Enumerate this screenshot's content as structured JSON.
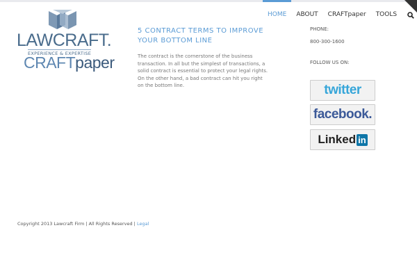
{
  "logo": {
    "law": "LAWCRAFT.",
    "tagline": "EXPERIENCE & EXPERTISE",
    "craft": "CRAFT",
    "paper": "paper"
  },
  "nav": {
    "items": [
      {
        "label": "HOME"
      },
      {
        "label": "ABOUT"
      },
      {
        "label": "CRAFTpaper"
      },
      {
        "label": "TOOLS"
      }
    ],
    "search_icon": "search-icon"
  },
  "article": {
    "title": "5 CONTRACT TERMS TO IMPROVE YOUR BOTTOM LINE",
    "body": "The contract is the cornerstone of the business transaction. In all but the simplest of transactions, a solid contract is essential to protect your legal rights. On the other hand, a bad contract can hit you right on the bottom line."
  },
  "sidebar": {
    "phone_label": "PHONE:",
    "phone": "800-300-1600",
    "follow_label": "FOLLOW US ON:",
    "twitter": "twitter",
    "facebook": "facebook.",
    "linkedin_text": "Linked",
    "linkedin_in": "in"
  },
  "footer": {
    "copyright": "Copyright 2013 Lawcraft Firm | All Rights Reserved | ",
    "legal_link": "Legal"
  },
  "colors": {
    "accent": "#5a9bd5",
    "logo_blue": "#4a6c8c"
  }
}
